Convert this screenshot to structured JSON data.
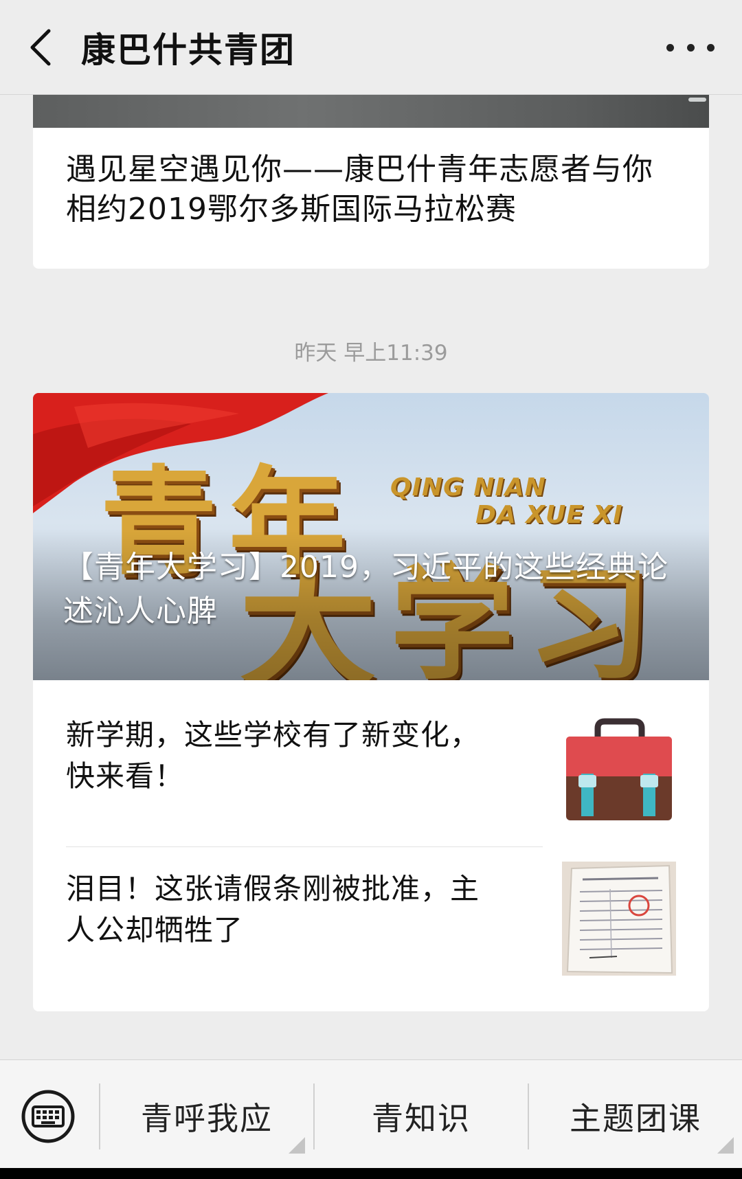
{
  "header": {
    "title": "康巴什共青团",
    "back_icon": "chevron-left-icon",
    "more_icon": "more-dots-icon"
  },
  "messages": [
    {
      "title": "遇见星空遇见你——康巴什青年志愿者与你相约2019鄂尔多斯国际马拉松赛"
    }
  ],
  "timestamp": "昨天 早上11:39",
  "news_group": {
    "cover": {
      "title": "【青年大学习】2019，习近平的这些经典论述沁人心脾",
      "image_big_text": "青年大学习",
      "image_latin_line1": "QING NIAN",
      "image_latin_line2": "DA XUE XI"
    },
    "items": [
      {
        "title": "新学期，这些学校有了新变化，快来看！",
        "thumb_icon": "school-bag-icon"
      },
      {
        "title": "泪目！这张请假条刚被批准，主人公却牺牲了",
        "thumb_icon": "leave-note-photo"
      }
    ]
  },
  "bottom_menu": {
    "keyboard_icon": "keyboard-icon",
    "items": [
      {
        "label": "青呼我应"
      },
      {
        "label": "青知识"
      },
      {
        "label": "主题团课"
      }
    ]
  },
  "colors": {
    "background": "#ededed",
    "card": "#ffffff",
    "timestamp": "#9b9b9b",
    "flag_red": "#d8201c",
    "gold": "#d9a63a"
  }
}
